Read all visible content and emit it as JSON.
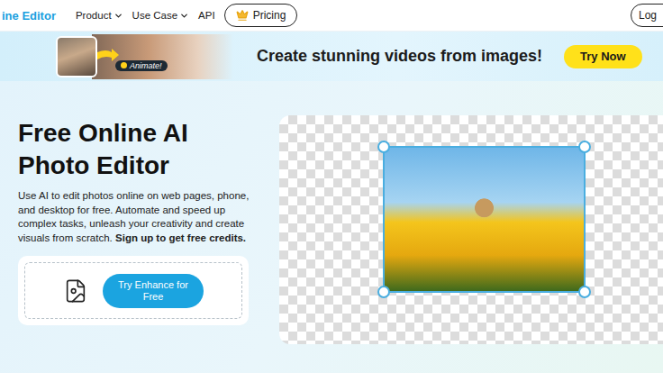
{
  "nav": {
    "logo": "ine Editor",
    "items": [
      {
        "label": "Product",
        "dropdown": true
      },
      {
        "label": "Use Case",
        "dropdown": true
      },
      {
        "label": "API",
        "dropdown": false
      }
    ],
    "pricing": "Pricing",
    "login": "Log"
  },
  "banner": {
    "badge": "Animate!",
    "headline": "Create stunning videos from images!",
    "button": "Try Now"
  },
  "hero": {
    "title": [
      "Free Online AI",
      "Photo Editor"
    ],
    "description": "Use AI to edit photos online on web pages, phone, and desktop for free. Automate and speed up complex tasks, unleash your creativity and create visuals from scratch.",
    "signup": "Sign up to get free credits.",
    "button": "Try Enhance for Free"
  }
}
